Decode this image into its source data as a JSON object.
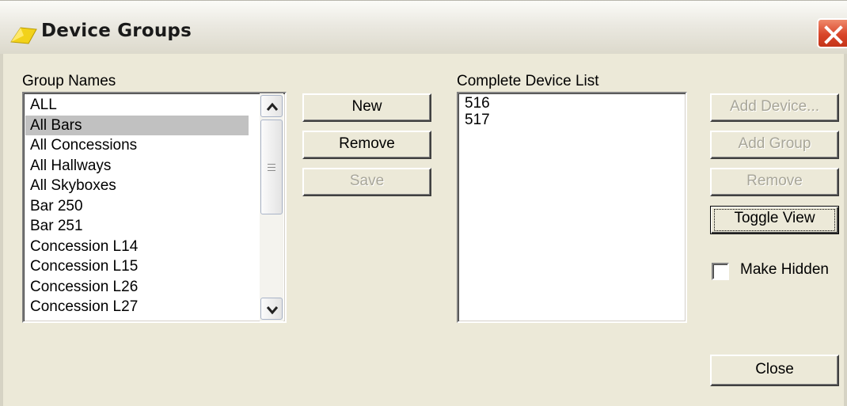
{
  "window": {
    "title": "Device Groups",
    "colors": {
      "face": "#ece9d8",
      "close": "#d9462a",
      "selection": "#c1c1c1"
    }
  },
  "group_names": {
    "label": "Group Names",
    "selected_index": 1,
    "items": [
      "ALL",
      "All Bars",
      "All Concessions",
      "All Hallways",
      "All Skyboxes",
      "Bar 250",
      "Bar 251",
      "Concession L14",
      "Concession L15",
      "Concession L26",
      "Concession L27"
    ]
  },
  "group_buttons": {
    "new": "New",
    "remove": "Remove",
    "save": "Save"
  },
  "device_list": {
    "label": "Complete Device List",
    "items": [
      "516",
      "517"
    ]
  },
  "device_buttons": {
    "add_device": "Add Device...",
    "add_group": "Add Group",
    "remove": "Remove",
    "toggle_view": "Toggle View"
  },
  "make_hidden": {
    "label": "Make Hidden",
    "checked": false
  },
  "close": "Close",
  "icons": {
    "app": "yellow-arrow-icon",
    "close": "close-icon",
    "scroll_up": "chevron-up-icon",
    "scroll_down": "chevron-down-icon"
  }
}
